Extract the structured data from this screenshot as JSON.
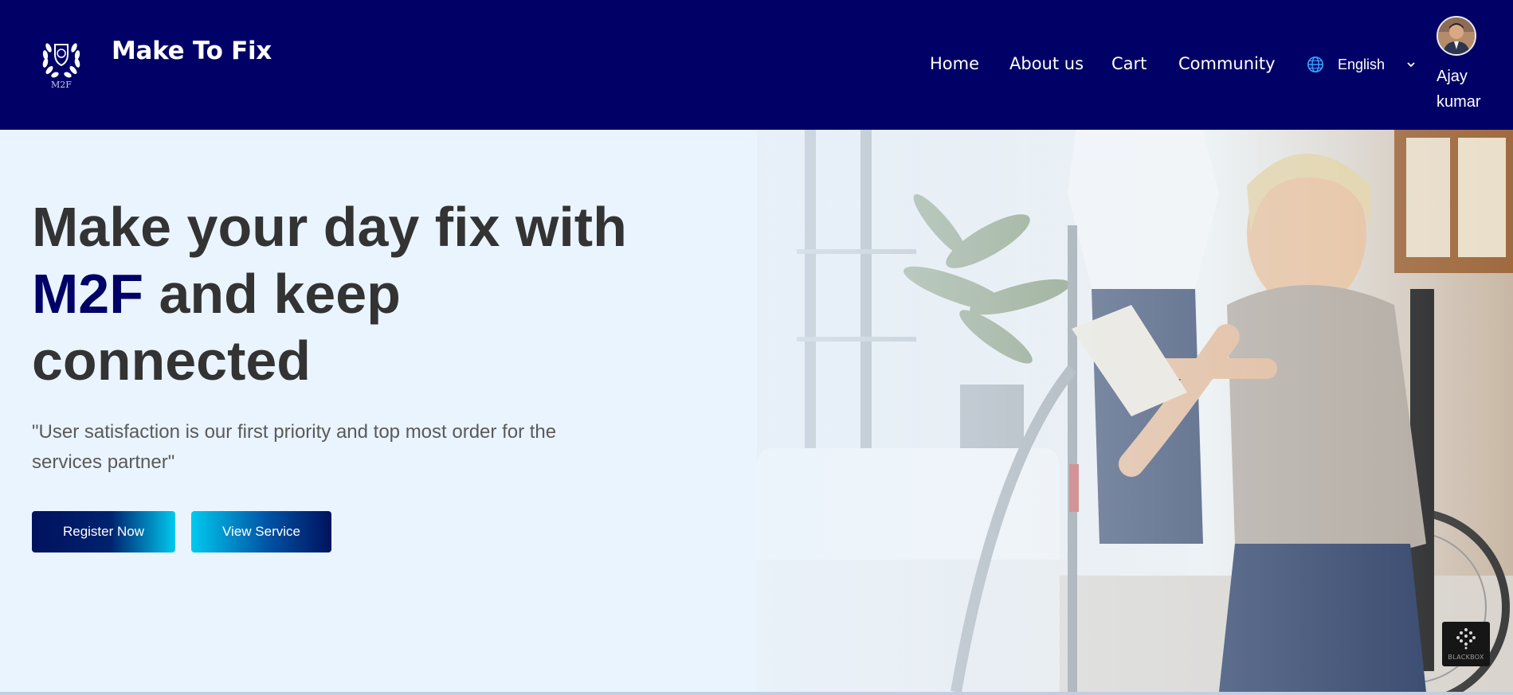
{
  "colors": {
    "header_bg": "#000066",
    "hero_bg": "#eaf4fe",
    "accent": "#000066",
    "heading_text": "#333333"
  },
  "header": {
    "logo_caption": "M2F",
    "brand": "Make To Fix",
    "nav": [
      {
        "label": "Home"
      },
      {
        "label": "About us"
      },
      {
        "label": "Cart"
      },
      {
        "label": "Community"
      }
    ],
    "language": {
      "icon": "globe-icon",
      "selected": "English"
    },
    "user": {
      "name": "Ajay kumar",
      "icon": "avatar"
    }
  },
  "hero": {
    "headline_part1": "Make your day fix with",
    "headline_accent": "M2F",
    "headline_part2": "and keep connected",
    "tagline": "\"User satisfaction is our first priority and top most order for the services partner\"",
    "buttons": {
      "register": "Register Now",
      "view_service": "View Service"
    }
  },
  "badge": {
    "text": "BLACKBOX"
  }
}
